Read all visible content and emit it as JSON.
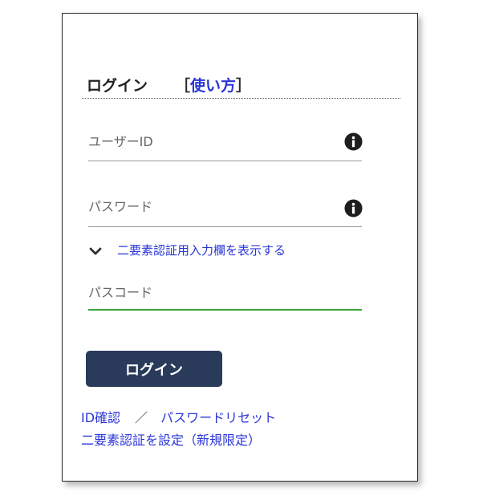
{
  "header": {
    "title": "ログイン",
    "howto_open": "［",
    "howto_label": "使い方",
    "howto_close": "］"
  },
  "fields": {
    "userid_placeholder": "ユーザーID",
    "password_placeholder": "パスワード",
    "passcode_placeholder": "パスコード"
  },
  "twofa": {
    "toggle_label": "二要素認証用入力欄を表示する"
  },
  "actions": {
    "login_label": "ログイン"
  },
  "links": {
    "id_confirm": "ID確認",
    "separator": "／",
    "password_reset": "パスワードリセット",
    "twofa_setup": "二要素認証を設定（新規限定）"
  },
  "colors": {
    "link": "#2a35d8",
    "button": "#2a3a5a",
    "passcode_underline": "#3aa53a"
  },
  "icons": {
    "info": "info-icon",
    "chevron": "chevron-down-icon"
  }
}
